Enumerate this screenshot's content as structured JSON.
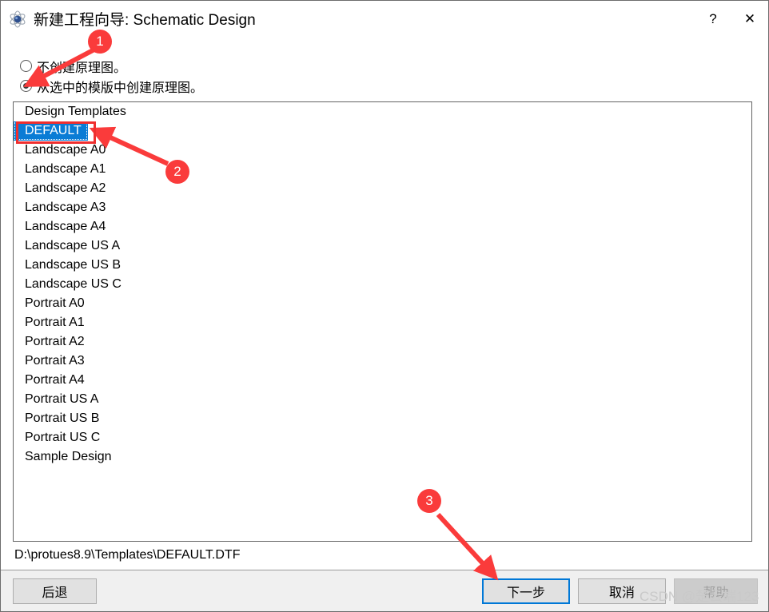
{
  "window": {
    "title": "新建工程向导: Schematic Design",
    "icon": "atom-icon",
    "help_button": "?",
    "close_button": "✕"
  },
  "options": {
    "items": [
      {
        "label": "不创建原理图。",
        "selected": false
      },
      {
        "label": "从选中的模版中创建原理图。",
        "selected": true
      }
    ]
  },
  "list": {
    "header": "Design Templates",
    "items": [
      "DEFAULT",
      "Landscape A0",
      "Landscape A1",
      "Landscape A2",
      "Landscape A3",
      "Landscape A4",
      "Landscape US A",
      "Landscape US B",
      "Landscape US C",
      "Portrait A0",
      "Portrait A1",
      "Portrait A2",
      "Portrait A3",
      "Portrait A4",
      "Portrait US A",
      "Portrait US B",
      "Portrait US C",
      "Sample Design"
    ],
    "selected": "DEFAULT"
  },
  "path": "D:\\protues8.9\\Templates\\DEFAULT.DTF",
  "footer": {
    "back_label": "后退",
    "next_label": "下一步",
    "cancel_label": "取消",
    "help_label": "帮助"
  },
  "annotations": {
    "markers": [
      "1",
      "2",
      "3"
    ]
  },
  "watermark": "CSDN @楚云端123",
  "colors": {
    "accent": "#0a7cd5",
    "focus": "#0078d7",
    "annotation": "#fa3b3b",
    "redbox": "#ef2f2f",
    "window_bg": "#f0f0f0"
  }
}
